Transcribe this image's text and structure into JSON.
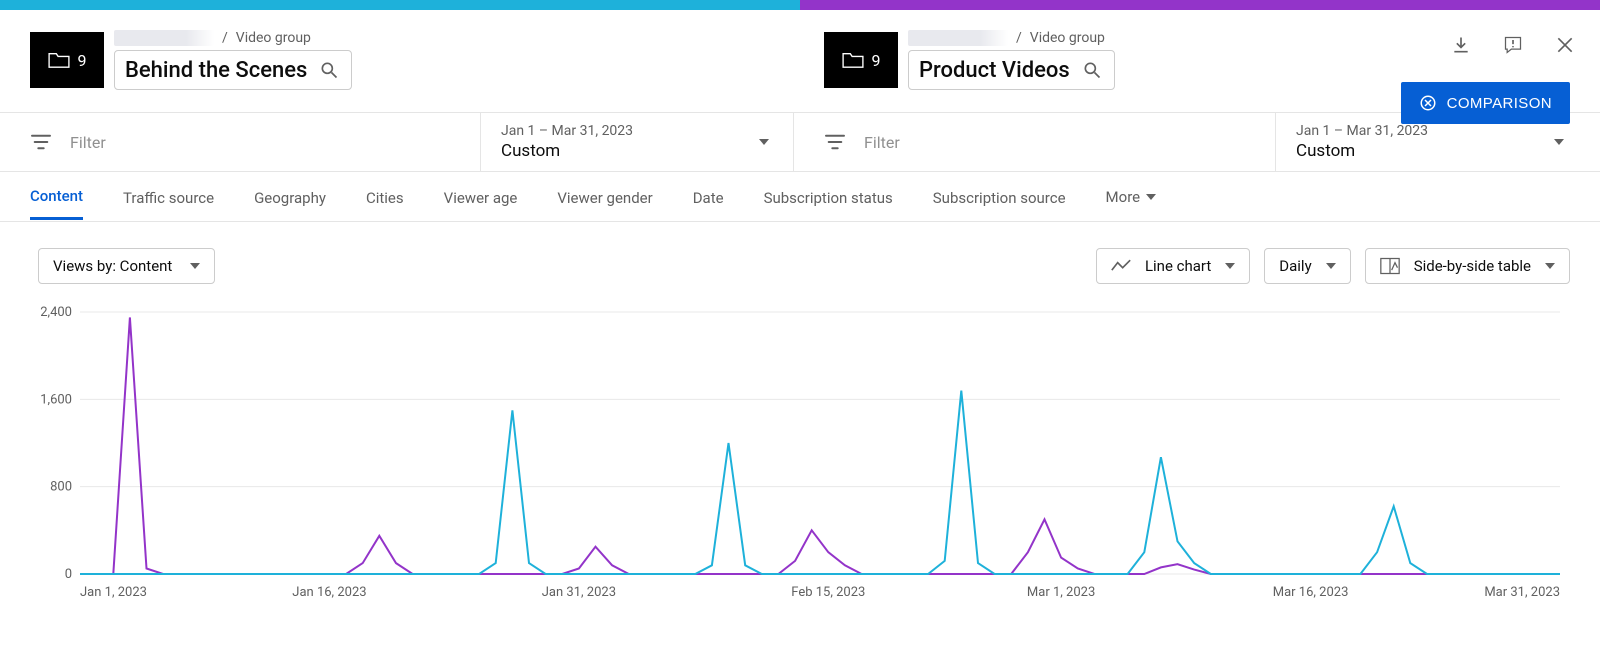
{
  "colors": {
    "left_accent": "#1eb1da",
    "right_accent": "#9334c9",
    "link_blue": "#065fd4"
  },
  "header": {
    "left": {
      "folder_count": "9",
      "breadcrumb_label": "Video group",
      "title": "Behind the Scenes"
    },
    "right": {
      "folder_count": "9",
      "breadcrumb_label": "Video group",
      "title": "Product Videos"
    },
    "comparison_button": "COMPARISON"
  },
  "filters": {
    "left": {
      "placeholder": "Filter",
      "date_range": "Jan 1 – Mar 31, 2023",
      "date_mode": "Custom"
    },
    "right": {
      "placeholder": "Filter",
      "date_range": "Jan 1 – Mar 31, 2023",
      "date_mode": "Custom"
    }
  },
  "tabs": {
    "items": [
      "Content",
      "Traffic source",
      "Geography",
      "Cities",
      "Viewer age",
      "Viewer gender",
      "Date",
      "Subscription status",
      "Subscription source"
    ],
    "active_index": 0,
    "more_label": "More"
  },
  "controls": {
    "views_by_label": "Views by: Content",
    "chart_type_label": "Line chart",
    "granularity_label": "Daily",
    "table_mode_label": "Side-by-side table"
  },
  "chart_data": {
    "type": "line",
    "title": "",
    "xlabel": "",
    "ylabel": "",
    "ylim": [
      0,
      2400
    ],
    "y_ticks": [
      0,
      800,
      1600,
      2400
    ],
    "x_tick_labels": [
      "Jan 1, 2023",
      "Jan 16, 2023",
      "Jan 31, 2023",
      "Feb 15, 2023",
      "Mar 1, 2023",
      "Mar 16, 2023",
      "Mar 31, 2023"
    ],
    "x_tick_positions": [
      0,
      15,
      30,
      45,
      59,
      74,
      89
    ],
    "n_days": 90,
    "series": [
      {
        "name": "Behind the Scenes",
        "color": "#9334c9",
        "values": [
          0,
          0,
          0,
          2350,
          50,
          0,
          0,
          0,
          0,
          0,
          0,
          0,
          0,
          0,
          0,
          0,
          0,
          100,
          350,
          100,
          0,
          0,
          0,
          0,
          0,
          0,
          0,
          0,
          0,
          0,
          50,
          250,
          80,
          0,
          0,
          0,
          0,
          0,
          0,
          0,
          0,
          0,
          0,
          120,
          400,
          200,
          80,
          0,
          0,
          0,
          0,
          0,
          0,
          0,
          0,
          0,
          0,
          200,
          500,
          150,
          50,
          0,
          0,
          0,
          0,
          60,
          90,
          40,
          0,
          0,
          0,
          0,
          0,
          0,
          0,
          0,
          0,
          0,
          0,
          0,
          0,
          0,
          0,
          0,
          0,
          0,
          0,
          0,
          0,
          0
        ]
      },
      {
        "name": "Product Videos",
        "color": "#1eb1da",
        "values": [
          0,
          0,
          0,
          0,
          0,
          0,
          0,
          0,
          0,
          0,
          0,
          0,
          0,
          0,
          0,
          0,
          0,
          0,
          0,
          0,
          0,
          0,
          0,
          0,
          0,
          100,
          1500,
          100,
          0,
          0,
          0,
          0,
          0,
          0,
          0,
          0,
          0,
          0,
          80,
          1200,
          80,
          0,
          0,
          0,
          0,
          0,
          0,
          0,
          0,
          0,
          0,
          0,
          120,
          1680,
          100,
          0,
          0,
          0,
          0,
          0,
          0,
          0,
          0,
          0,
          200,
          1070,
          300,
          100,
          0,
          0,
          0,
          0,
          0,
          0,
          0,
          0,
          0,
          0,
          200,
          620,
          100,
          0,
          0,
          0,
          0,
          0,
          0,
          0,
          0,
          0
        ]
      }
    ]
  }
}
